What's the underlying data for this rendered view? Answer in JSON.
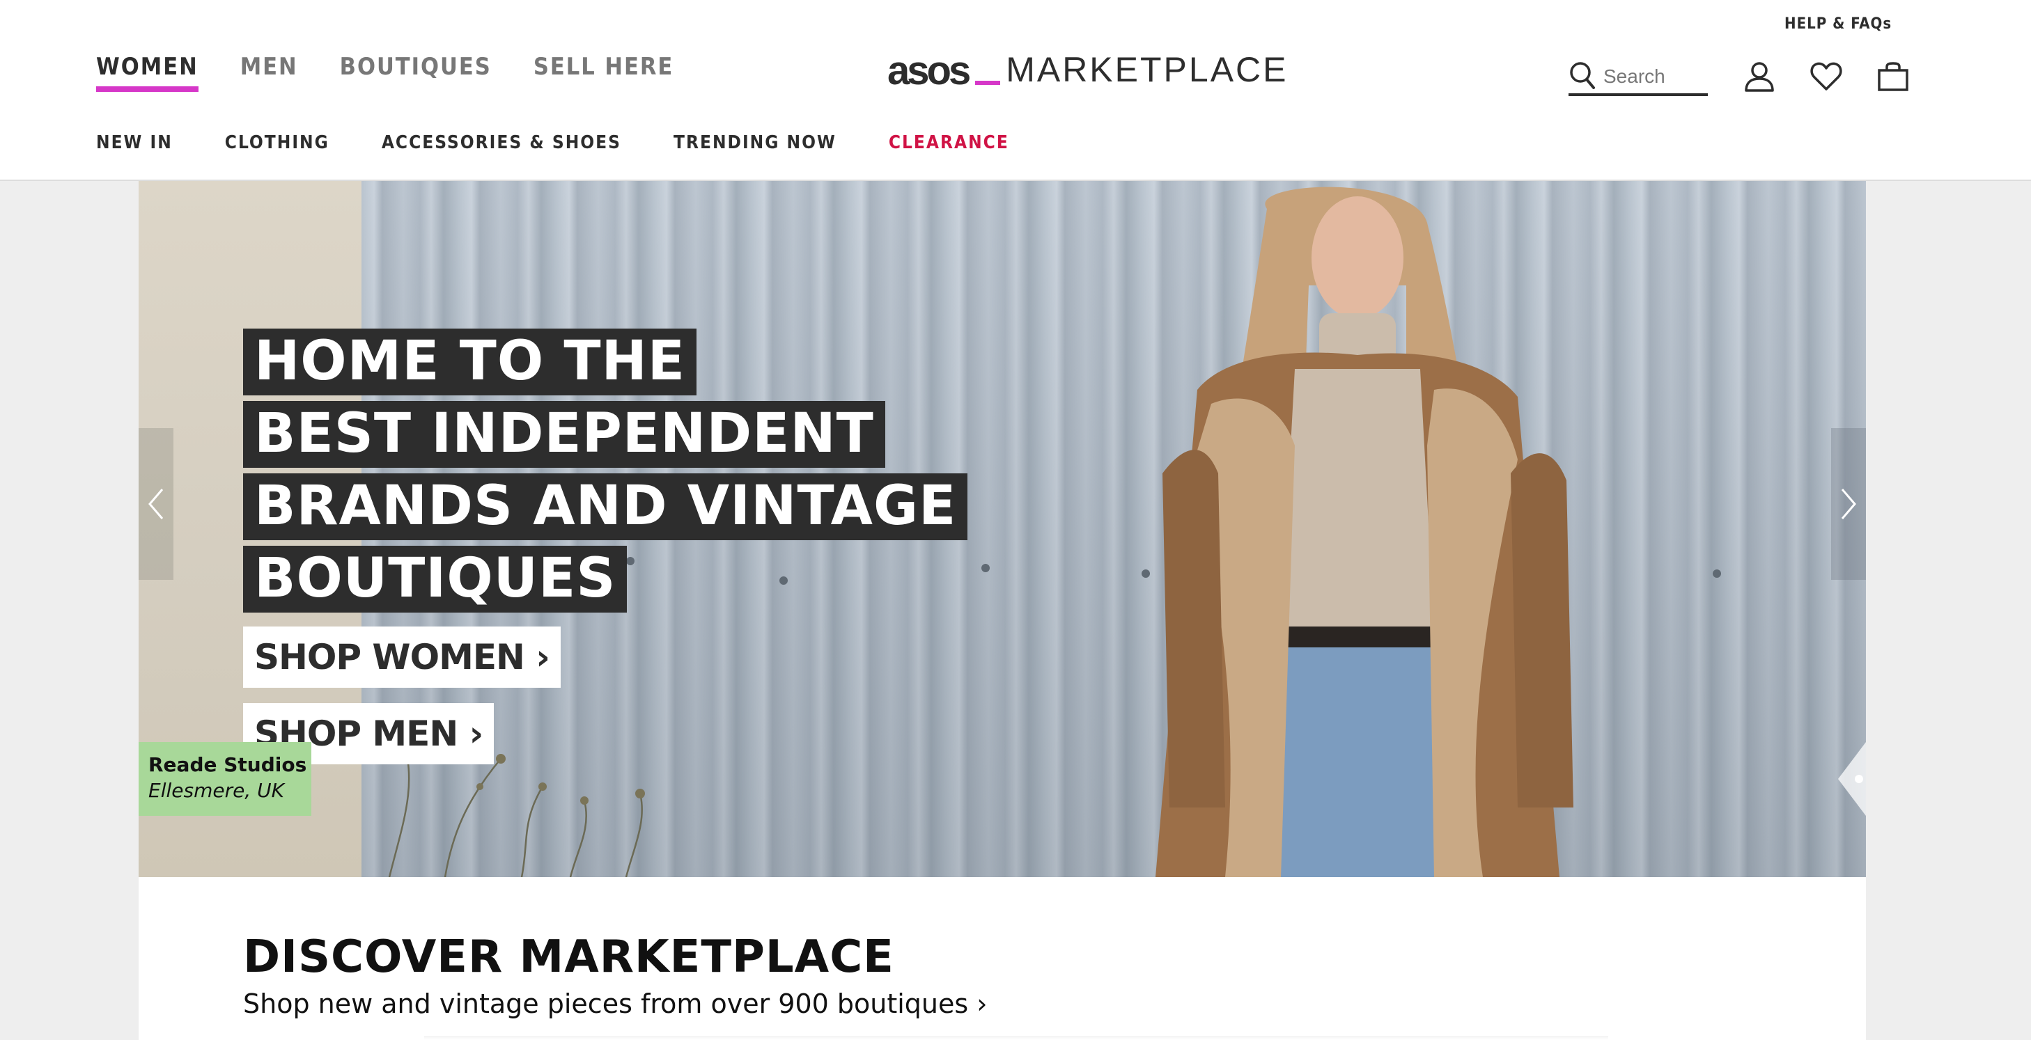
{
  "header": {
    "help_link": "HELP & FAQs",
    "primary_nav": [
      {
        "label": "WOMEN",
        "active": true
      },
      {
        "label": "MEN",
        "active": false
      },
      {
        "label": "BOUTIQUES",
        "active": false
      },
      {
        "label": "SELL HERE",
        "active": false
      }
    ],
    "logo": {
      "brand": "asos",
      "suffix": "MARKETPLACE"
    },
    "search": {
      "placeholder": "Search",
      "icon": "search-icon"
    },
    "icons": [
      "account-icon",
      "heart-icon",
      "bag-icon"
    ],
    "secondary_nav": [
      {
        "label": "NEW IN"
      },
      {
        "label": "CLOTHING"
      },
      {
        "label": "ACCESSORIES & SHOES"
      },
      {
        "label": "TRENDING NOW"
      },
      {
        "label": "CLEARANCE"
      }
    ],
    "colors": {
      "accent": "#d637c8",
      "clearance": "#d01345",
      "text": "#2d2d2d"
    }
  },
  "hero": {
    "headline_lines": [
      "HOME TO THE",
      "BEST INDEPENDENT",
      "BRANDS AND VINTAGE",
      "BOUTIQUES"
    ],
    "shop_women": "SHOP WOMEN ›",
    "shop_men": "SHOP MEN ›",
    "credit": {
      "name": "Reade Studios",
      "location": "Ellesmere, UK"
    },
    "colors": {
      "credit_bg": "#a8d899",
      "headline_bg": "#2d2d2d"
    }
  },
  "discover": {
    "title": "DISCOVER MARKETPLACE",
    "subtitle": "Shop new and vintage pieces from over 900 boutiques ›"
  }
}
